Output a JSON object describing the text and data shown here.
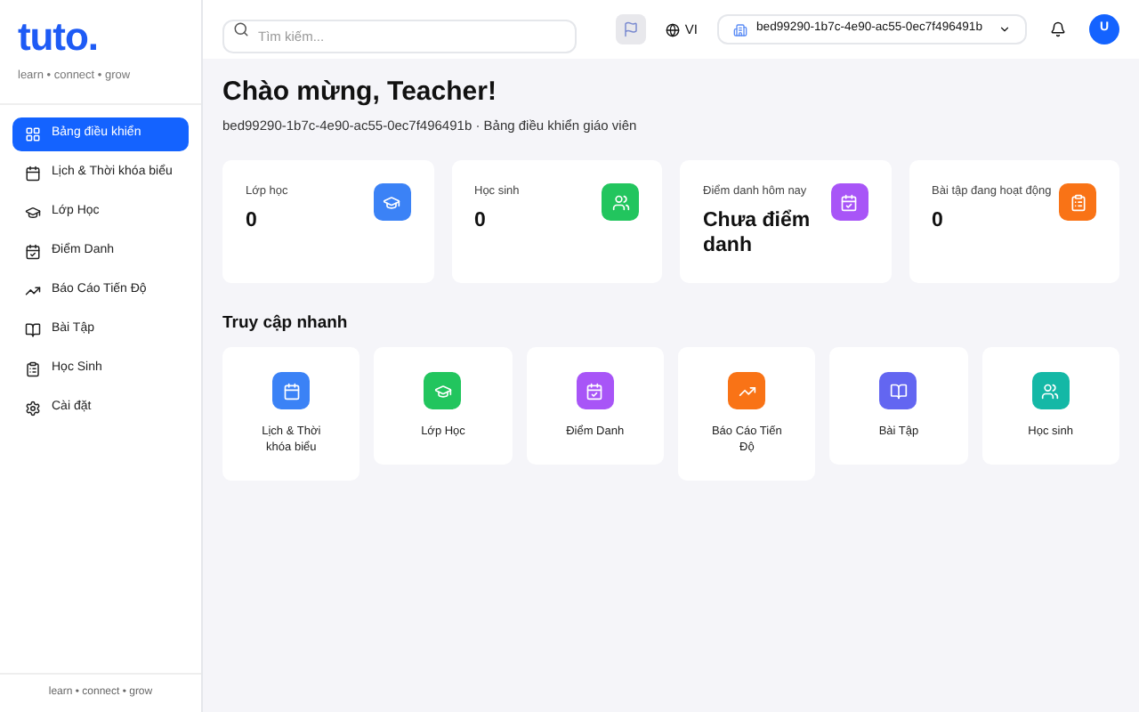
{
  "brand": {
    "logo": "tuto.",
    "tagline": "learn • connect • grow"
  },
  "sidebar": {
    "items": [
      {
        "label": "Bảng điều khiển",
        "selected": true
      },
      {
        "label": "Lịch & Thời khóa biểu",
        "selected": false
      },
      {
        "label": "Lớp Học",
        "selected": false
      },
      {
        "label": "Điểm Danh",
        "selected": false
      },
      {
        "label": "Báo Cáo Tiến Độ",
        "selected": false
      },
      {
        "label": "Bài Tập",
        "selected": false
      },
      {
        "label": "Học Sinh",
        "selected": false
      },
      {
        "label": "Cài đặt",
        "selected": false
      }
    ],
    "footer": "learn • connect • grow"
  },
  "header": {
    "search": {
      "placeholder": "Tìm kiếm..."
    },
    "language": "VI",
    "workspace": "bed99290-1b7c-4e90-ac55-0ec7f496491b",
    "avatar": "U"
  },
  "title": "Chào mừng, Teacher!",
  "subtitle": "bed99290-1b7c-4e90-ac55-0ec7f496491b · Bảng điều khiển giáo viên",
  "stats": [
    {
      "label": "Lớp học",
      "value": "0",
      "color": "#3b82f6"
    },
    {
      "label": "Học sinh",
      "value": "0",
      "color": "#22c55e"
    },
    {
      "label": "Điểm danh hôm nay",
      "value": "Chưa điểm danh",
      "color": "#a855f7"
    },
    {
      "label": "Bài tập đang hoạt động",
      "value": "0",
      "color": "#f97316"
    }
  ],
  "quick_access": {
    "title": "Truy cập nhanh",
    "items": [
      {
        "label": "Lịch & Thời khóa biểu",
        "color": "#3b82f6"
      },
      {
        "label": "Lớp Học",
        "color": "#22c55e"
      },
      {
        "label": "Điểm Danh",
        "color": "#a855f7"
      },
      {
        "label": "Báo Cáo Tiến Độ",
        "color": "#f97316"
      },
      {
        "label": "Bài Tập",
        "color": "#6366f1"
      },
      {
        "label": "Học sinh",
        "color": "#14b8a6"
      }
    ]
  }
}
